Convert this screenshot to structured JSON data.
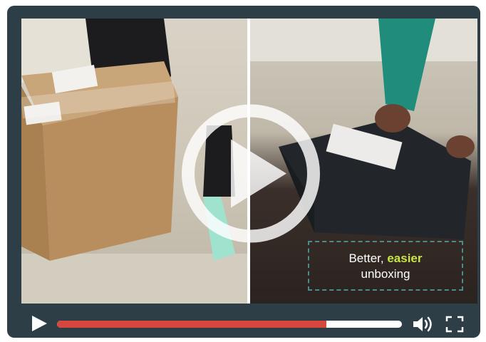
{
  "video": {
    "caption_prefix": "Better, ",
    "caption_highlight": "easier",
    "caption_line2": "unboxing"
  },
  "controls": {
    "progress_fraction": 0.78
  },
  "colors": {
    "player_frame": "#2d3e47",
    "progress_fill": "#d8473d",
    "caption_highlight": "#c7e645"
  },
  "icons": [
    "play-icon",
    "big-play-icon",
    "volume-icon",
    "fullscreen-icon"
  ]
}
